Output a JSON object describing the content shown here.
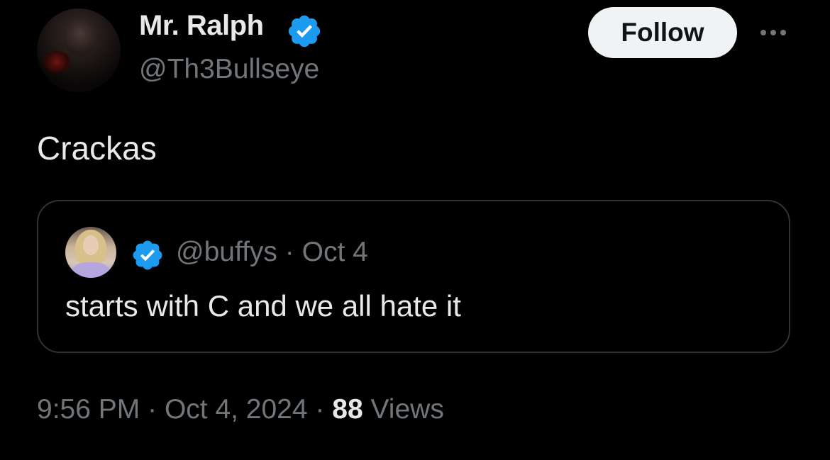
{
  "tweet": {
    "author": {
      "display_name": "Mr. Ralph",
      "handle": "@Th3Bullseye",
      "verified": true,
      "avatar_icon": "profile-photo"
    },
    "follow_label": "Follow",
    "more_icon": "more-dots-icon",
    "text": "Crackas",
    "quoted_tweet": {
      "handle": "@buffys",
      "separator": "·",
      "date": "Oct 4",
      "verified": true,
      "text": "starts with C and we all hate it"
    },
    "footer": {
      "time": "9:56 PM",
      "separator1": "·",
      "date": "Oct 4, 2024",
      "separator2": "·",
      "views_count": "88",
      "views_label": "Views"
    }
  },
  "colors": {
    "background": "#000000",
    "primary_text": "#e7e9ea",
    "secondary_text": "#71767b",
    "verified_blue": "#1d9bf0",
    "border": "#2f3336",
    "follow_bg": "#eff3f4"
  }
}
